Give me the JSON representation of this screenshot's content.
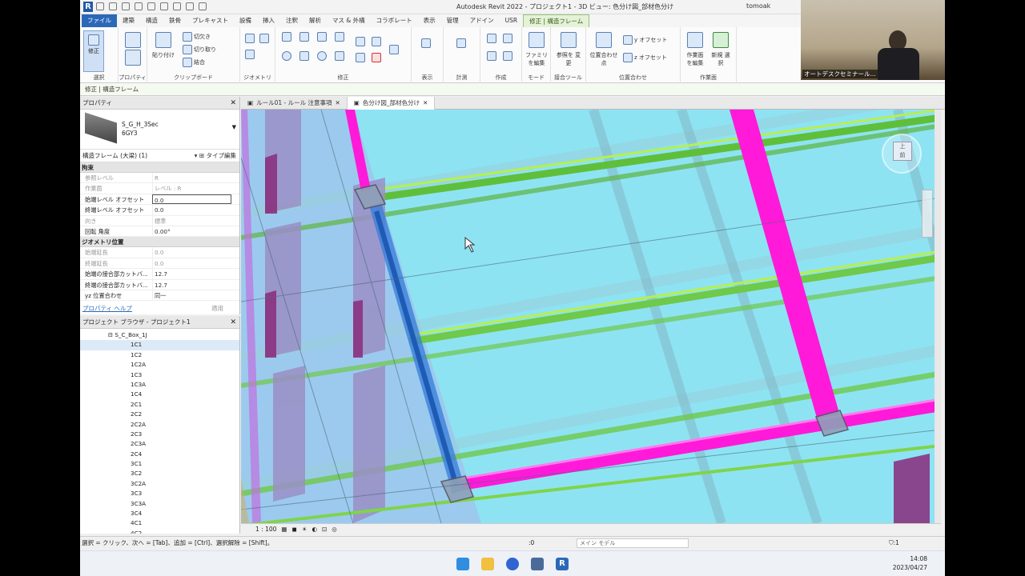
{
  "window": {
    "title": "Autodesk Revit 2022 - プロジェクト1 - 3D ビュー: 色分け図_部材色分け",
    "user": "tomoak"
  },
  "ribbon_tabs": [
    "ファイル",
    "建築",
    "構造",
    "鉄骨",
    "プレキャスト",
    "設備",
    "挿入",
    "注釈",
    "解析",
    "マス & 外構",
    "コラボレート",
    "表示",
    "管理",
    "アドイン",
    "USR",
    "修正 | 構造フレーム"
  ],
  "ribbon": {
    "modify_label": "修正",
    "paste_label": "貼り付け",
    "cut_label": "切欠き",
    "cutoff_label": "切り取り",
    "join_label": "結合",
    "yz_offset_y": "y オフセット",
    "yz_offset_z": "z オフセット",
    "family_edit": "ファミリ を編集",
    "ref_change": "参照を 変更",
    "align_point": "位置合わせ 点",
    "workplane_edit": "作業面 を編集",
    "new_select": "新規 選択",
    "panels": [
      "選択",
      "プロパティ",
      "クリップボード",
      "ジオメトリ",
      "修正",
      "表示",
      "計測",
      "作成",
      "モード",
      "接合ツール",
      "位置合わせ",
      "作業面"
    ]
  },
  "context_bar": "修正 | 構造フレーム",
  "properties": {
    "title": "プロパティ",
    "type_name": "S_G_H_3Sec",
    "type_sub": "6GY3",
    "filter": "構造フレーム (大梁) (1)",
    "type_edit": "タイプ編集",
    "groups": [
      {
        "name": "拘束",
        "rows": [
          {
            "k": "参照レベル",
            "v": "R",
            "dim": true
          },
          {
            "k": "作業面",
            "v": "レベル : R",
            "dim": true
          },
          {
            "k": "始端レベル オフセット",
            "v": "0.0",
            "edit": true
          },
          {
            "k": "終端レベル オフセット",
            "v": "0.0"
          },
          {
            "k": "向き",
            "v": "標準",
            "dim": true
          },
          {
            "k": "回転 角度",
            "v": "0.00°"
          }
        ]
      },
      {
        "name": "ジオメトリ位置",
        "rows": [
          {
            "k": "始端延長",
            "v": "0.0",
            "dim": true
          },
          {
            "k": "終端延長",
            "v": "0.0",
            "dim": true
          },
          {
            "k": "始端の接合部カットバ...",
            "v": "12.7"
          },
          {
            "k": "終端の接合部カットバ...",
            "v": "12.7"
          },
          {
            "k": "yz 位置合わせ",
            "v": "同一"
          }
        ]
      }
    ],
    "help": "プロパティ ヘルプ",
    "apply": "適用"
  },
  "browser": {
    "title": "プロジェクト ブラウザ - プロジェクト1",
    "folder": "S_C_Box_1J",
    "items": [
      "1C1",
      "1C2",
      "1C2A",
      "1C3",
      "1C3A",
      "1C4",
      "2C1",
      "2C2",
      "2C2A",
      "2C3",
      "2C3A",
      "2C4",
      "3C1",
      "3C2",
      "3C2A",
      "3C3",
      "3C3A",
      "3C4",
      "4C1",
      "4C2"
    ]
  },
  "view_tabs": [
    "ルール01 - ルール 注意事項",
    "色分け図_部材色分け"
  ],
  "view_control": {
    "scale": "1 : 100"
  },
  "status": {
    "hint": "選択 = クリック、次へ = [Tab]、追加 = [Ctrl]、選択解除 = [Shift]。",
    "count": ":0",
    "model": "メイン モデル"
  },
  "viewcube": {
    "top": "上",
    "front": "前"
  },
  "clock": {
    "time": "14:08",
    "date": "2023/04/27"
  },
  "webcam_caption": "オートデスクセミナール...",
  "colors": {
    "magenta": "#ff1ad9",
    "green": "#7fd44a",
    "cyan": "#8ee3f3",
    "selected_blue": "#3b7fd9"
  }
}
